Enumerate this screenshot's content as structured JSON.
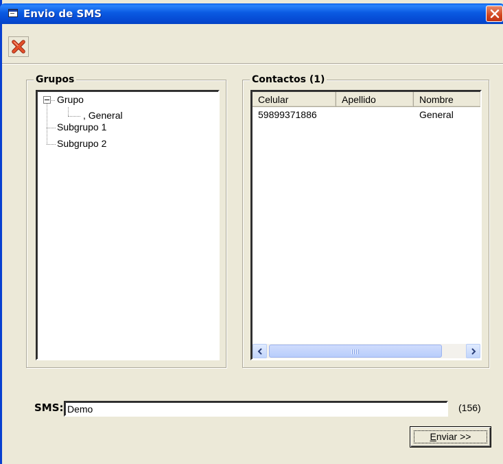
{
  "window": {
    "title": "Envio de SMS"
  },
  "toolbar": {
    "close_tool": "close-icon"
  },
  "grupos": {
    "label": "Grupos",
    "tree": [
      {
        "label": "Grupo",
        "expanded": true
      },
      {
        "label": ", General"
      },
      {
        "label": "Subgrupo 1"
      },
      {
        "label": "Subgrupo 2"
      }
    ]
  },
  "contactos": {
    "label": "Contactos (1)",
    "columns": [
      "Celular",
      "Apellido",
      "Nombre"
    ],
    "rows": [
      {
        "celular": "59899371886",
        "apellido": "",
        "nombre": "General"
      }
    ],
    "scroll_grip": "III"
  },
  "sms": {
    "label": "SMS:",
    "value": "Demo",
    "counter": "(156)"
  },
  "send_button": {
    "label_prefix": "",
    "label_underlined": "E",
    "label_rest": "nviar >>"
  },
  "colors": {
    "titlebar": "#0a5ae2",
    "window_bg": "#ece9d8",
    "close_red": "#d2461f"
  }
}
